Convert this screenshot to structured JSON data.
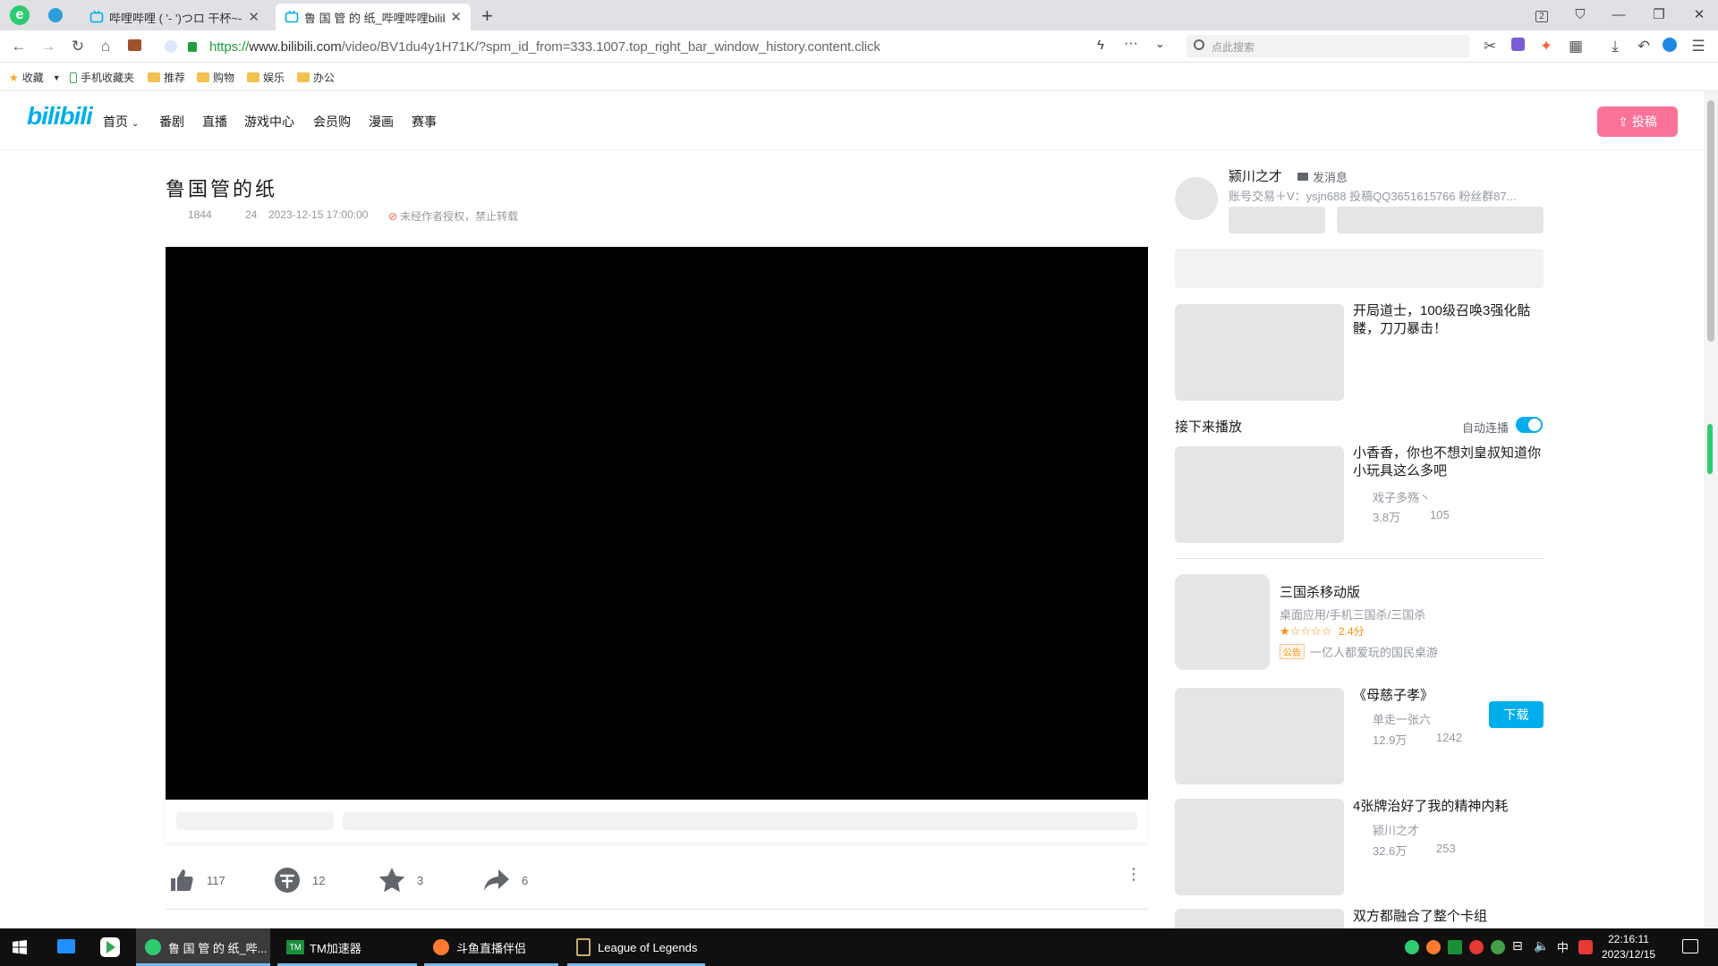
{
  "browser": {
    "tabs": [
      {
        "label": "哔哩哔哩 ( '- ')つロ 干杯~-bi",
        "active": false
      },
      {
        "label": "鲁 国 管 的 纸_哔哩哔哩bilibili",
        "active": true
      }
    ],
    "url_proto": "https://",
    "url_host": "www.bilibili.com",
    "url_path": "/video/BV1du4y1H71K/?spm_id_from=333.1007.top_right_bar_window_history.content.click",
    "search_placeholder": "点此搜索",
    "tab_count": "2",
    "bookmarks": [
      "收藏",
      "手机收藏夹",
      "推荐",
      "购物",
      "娱乐",
      "办公"
    ]
  },
  "site": {
    "logo": "bilibili",
    "nav": [
      "首页",
      "番剧",
      "直播",
      "游戏中心",
      "会员购",
      "漫画",
      "赛事"
    ],
    "upload_label": "投稿"
  },
  "video": {
    "title": "鲁国管的纸",
    "views": "1844",
    "danmaku": "24",
    "date": "2023-12-15 17:00:00",
    "copyright": "未经作者授权，禁止转载",
    "likes": "117",
    "coins": "12",
    "favorites": "3",
    "shares": "6"
  },
  "uploader": {
    "name": "颍川之才",
    "message_label": "发消息",
    "description": "账号交易＋V：ysjn688 投稿QQ3651615766 粉丝群87..."
  },
  "sidebar": {
    "first_card": {
      "title": "开局道士，100级召唤3强化骷髅，刀刀暴击！"
    },
    "next_label": "接下来播放",
    "autoplay_label": "自动连播",
    "next_card": {
      "title": "小香香，你也不想刘皇叔知道你小玩具这么多吧",
      "author": "戏子多殇丶",
      "views": "3.8万",
      "danmaku": "105"
    },
    "ad": {
      "title": "三国杀移动版",
      "category": "桌面应用/手机三国杀/三国杀",
      "rating": "2.4分",
      "rating_stars": 1,
      "tag": "公告",
      "slogan": "一亿人都爱玩的国民桌游",
      "button": "下载"
    },
    "cards": [
      {
        "title": "《母慈子孝》",
        "author": "单走一张六",
        "views": "12.9万",
        "danmaku": "1242"
      },
      {
        "title": "4张牌治好了我的精神内耗",
        "author": "颍川之才",
        "views": "32.6万",
        "danmaku": "253"
      },
      {
        "title": "双方都融合了整个卡组"
      }
    ]
  },
  "taskbar": {
    "apps": [
      {
        "label": "鲁 国 管 的 纸_哔...",
        "active": true
      },
      {
        "label": "TM加速器",
        "active": false
      },
      {
        "label": "斗鱼直播伴侣",
        "active": false
      },
      {
        "label": "League of Legends",
        "active": false
      }
    ],
    "ime": "中",
    "time": "22:16:11",
    "date": "2023/12/15"
  }
}
